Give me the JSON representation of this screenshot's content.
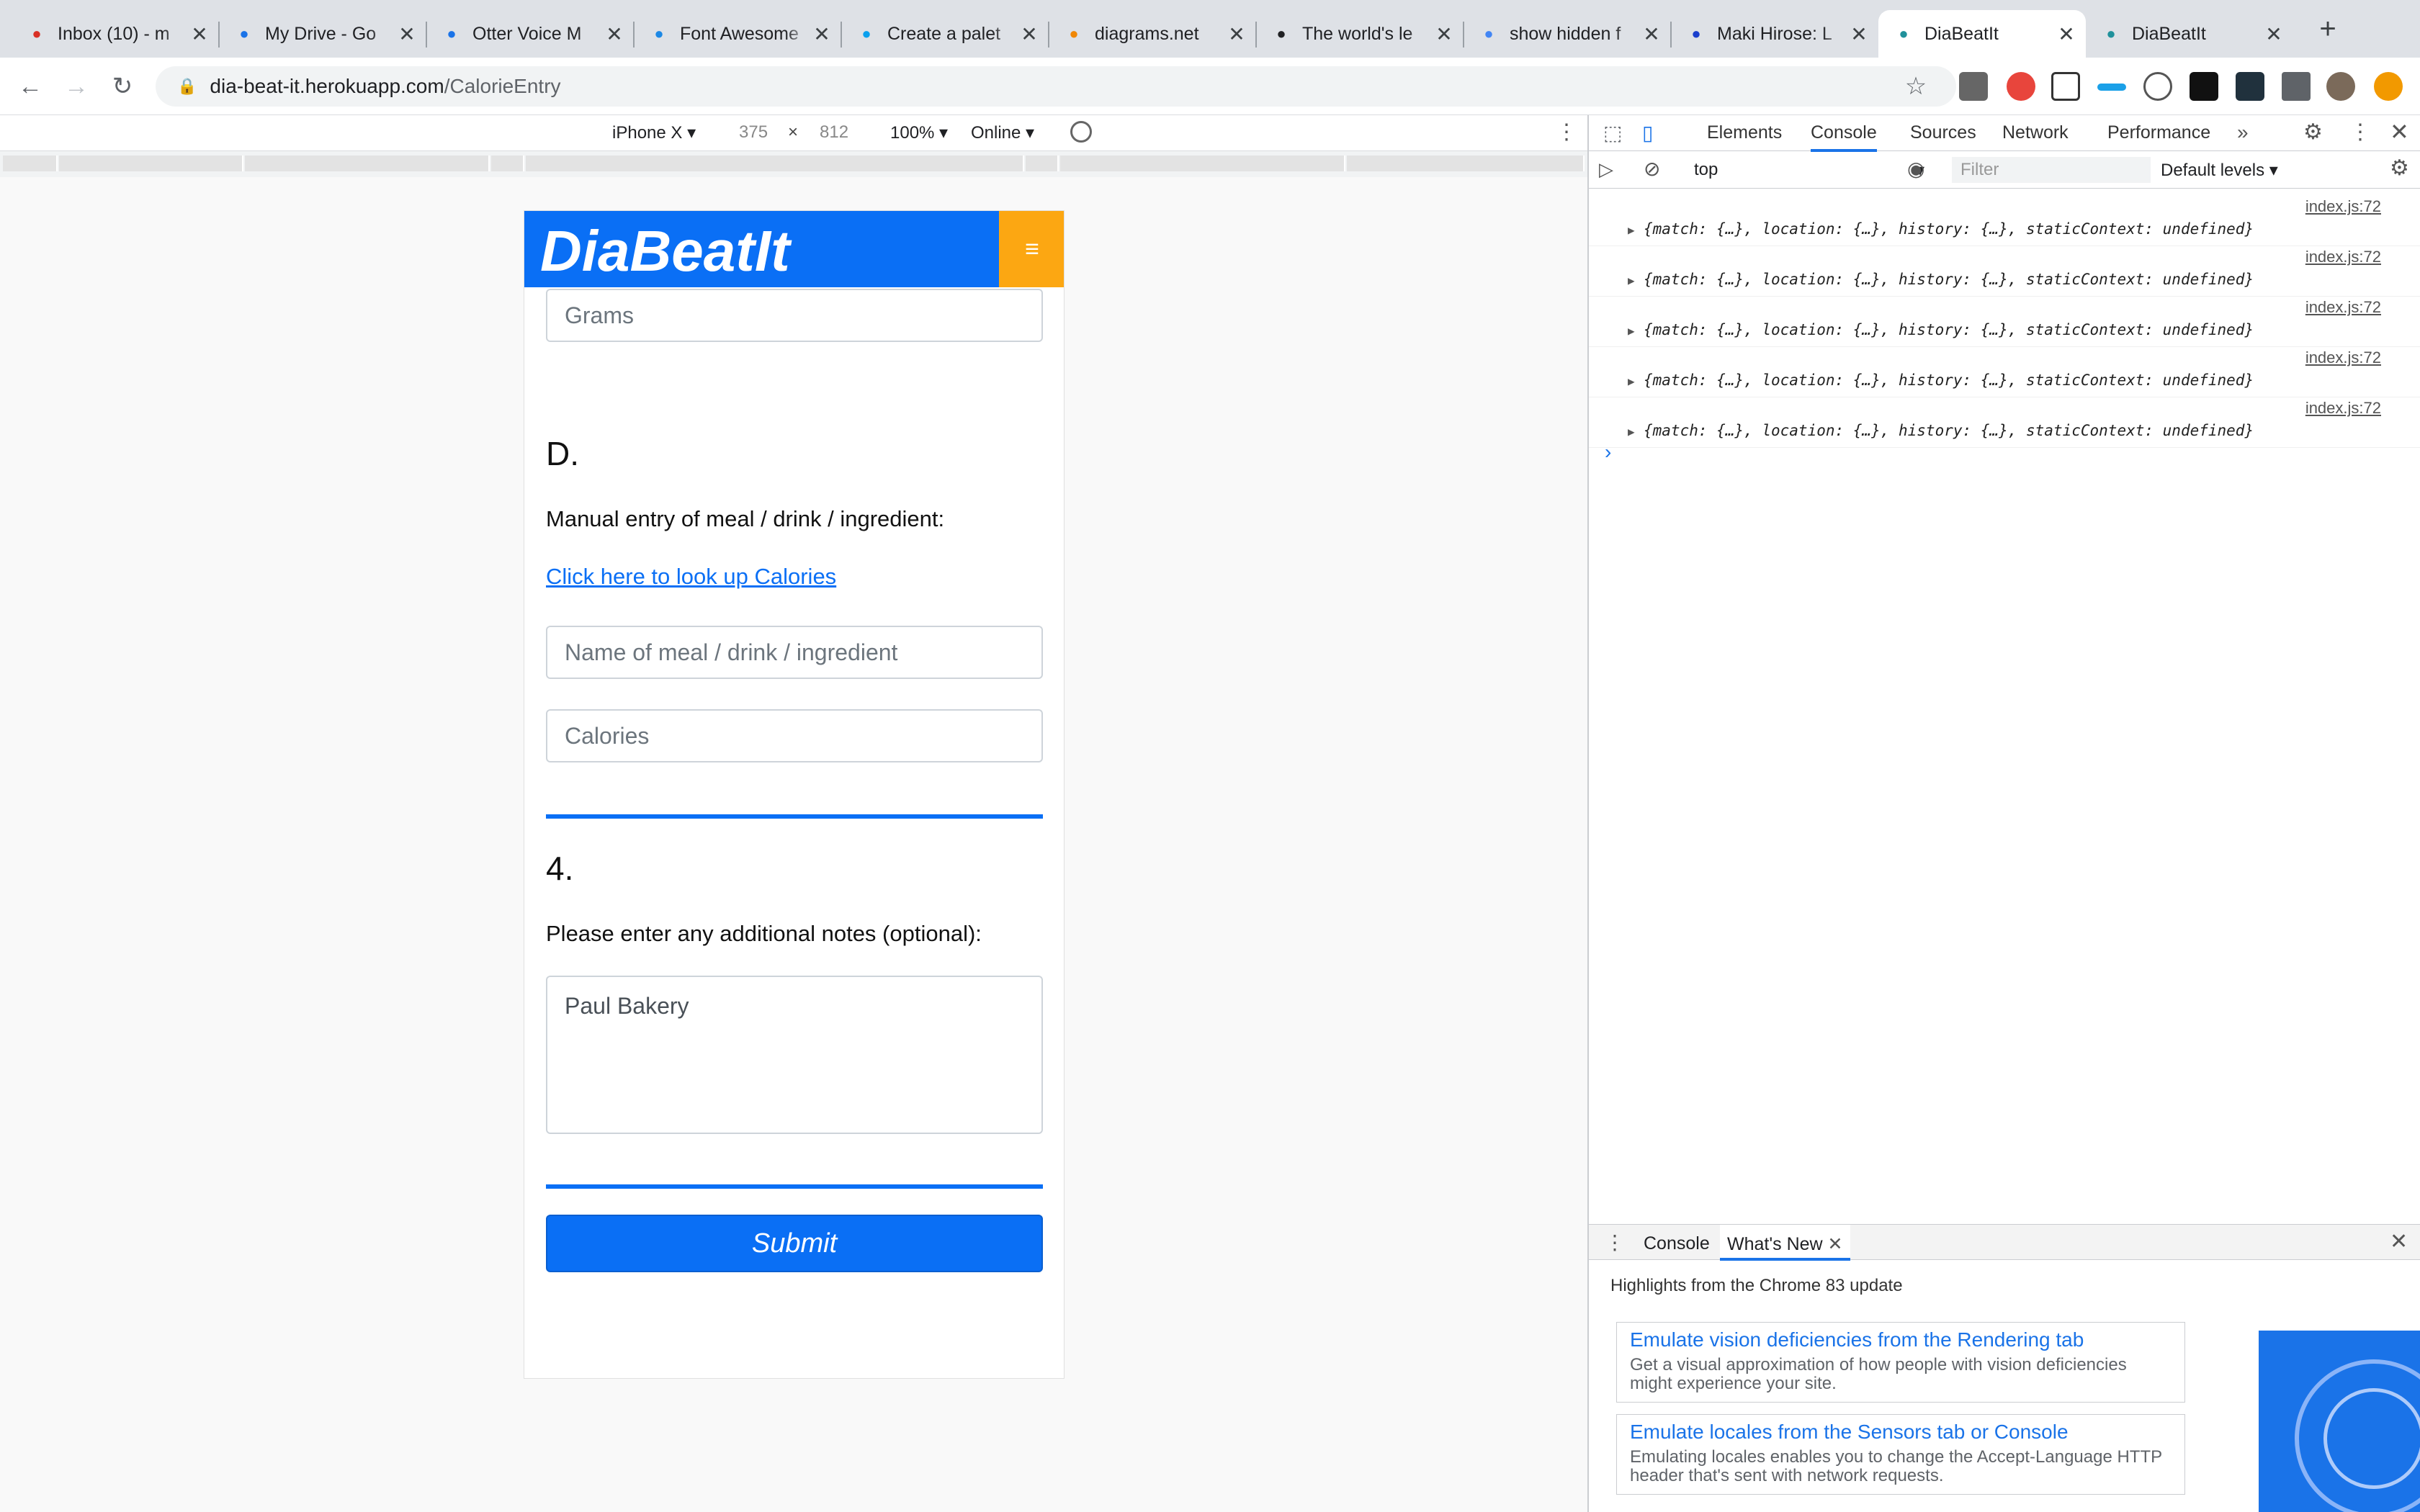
{
  "browser": {
    "tabs": [
      {
        "title": "Inbox (10) - m",
        "icon": "gmail-icon",
        "color": "#d93025"
      },
      {
        "title": "My Drive - Go",
        "icon": "drive-icon",
        "color": "#1a73e8"
      },
      {
        "title": "Otter Voice M",
        "icon": "otter-icon",
        "color": "#1a73e8"
      },
      {
        "title": "Font Awesome",
        "icon": "flag-icon",
        "color": "#1c88e5"
      },
      {
        "title": "Create a palet",
        "icon": "coolors-icon",
        "color": "#0aa0ee"
      },
      {
        "title": "diagrams.net",
        "icon": "diagrams-icon",
        "color": "#f08705"
      },
      {
        "title": "The world's le",
        "icon": "github-icon",
        "color": "#202124"
      },
      {
        "title": "show hidden f",
        "icon": "google-icon",
        "color": "#4285f4"
      },
      {
        "title": "Maki Hirose: L",
        "icon": "square-icon",
        "color": "#1a3fcd"
      },
      {
        "title": "DiaBeatIt",
        "icon": "react-icon",
        "color": "#20919b"
      },
      {
        "title": "DiaBeatIt",
        "icon": "react-icon",
        "color": "#20919b"
      }
    ],
    "new_tab": "+",
    "url_host": "dia-beat-it.herokuapp.com",
    "url_path": "/CalorieEntry"
  },
  "device_toolbar": {
    "device": "iPhone X",
    "width": "375",
    "times": "×",
    "height": "812",
    "zoom": "100%",
    "network": "Online"
  },
  "app": {
    "brand": "DiaBeatIt",
    "menu_glyph": "≡",
    "grams_placeholder": "Grams",
    "section_d": "D.",
    "manual_entry_label": "Manual entry of meal / drink / ingredient:",
    "lookup_link": "Click here to look up Calories",
    "name_placeholder": "Name of meal / drink / ingredient",
    "calories_placeholder": "Calories",
    "section_4": "4.",
    "notes_label": "Please enter any additional notes (optional):",
    "notes_value": "Paul Bakery",
    "submit_label": "Submit",
    "accent": "#0a6ff5",
    "menu_color": "#fca712"
  },
  "devtools": {
    "tabs": [
      "Elements",
      "Console",
      "Sources",
      "Network",
      "Performance"
    ],
    "more": "»",
    "context": "top",
    "filter_placeholder": "Filter",
    "levels": "Default levels",
    "logs": [
      {
        "source": "index.js:72",
        "message": "{match: {…}, location: {…}, history: {…}, staticContext: undefined}"
      },
      {
        "source": "index.js:72",
        "message": "{match: {…}, location: {…}, history: {…}, staticContext: undefined}"
      },
      {
        "source": "index.js:72",
        "message": "{match: {…}, location: {…}, history: {…}, staticContext: undefined}"
      },
      {
        "source": "index.js:72",
        "message": "{match: {…}, location: {…}, history: {…}, staticContext: undefined}"
      },
      {
        "source": "index.js:72",
        "message": "{match: {…}, location: {…}, history: {…}, staticContext: undefined}"
      }
    ],
    "prompt": "›",
    "drawer_tabs": [
      "Console",
      "What's New"
    ],
    "highlights": "Highlights from the Chrome 83 update",
    "cards": [
      {
        "title": "Emulate vision deficiencies from the Rendering tab",
        "desc": "Get a visual approximation of how people with vision deficiencies might experience your site."
      },
      {
        "title": "Emulate locales from the Sensors tab or Console",
        "desc": "Emulating locales enables you to change the Accept-Language HTTP header that's sent with network requests."
      }
    ]
  }
}
